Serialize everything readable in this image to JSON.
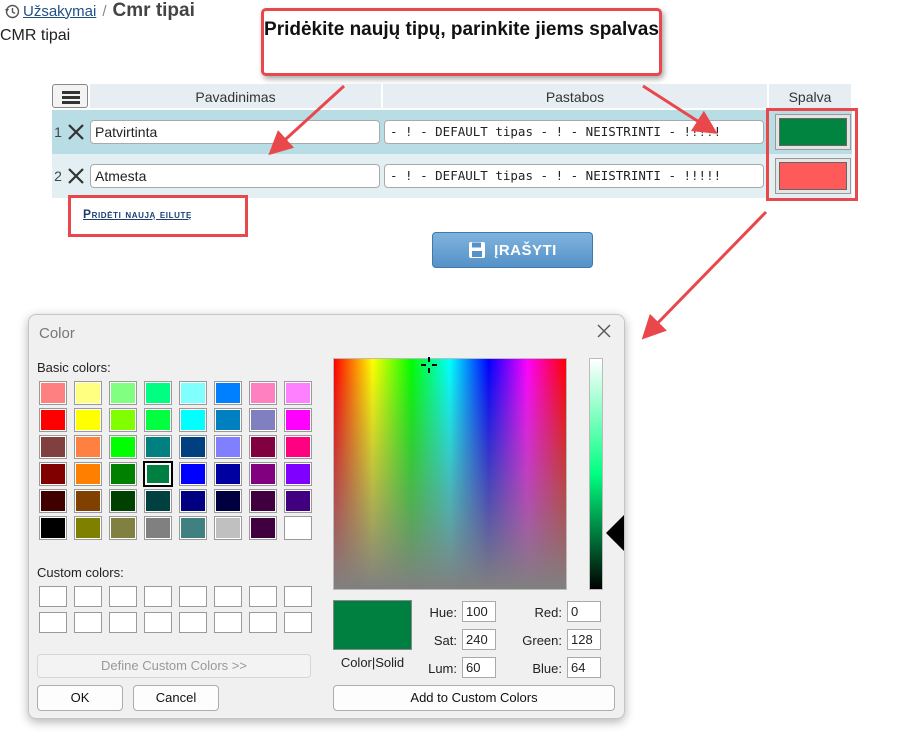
{
  "breadcrumb": {
    "parent": "Užsakymai",
    "separator": "/",
    "current": "Cmr tipai"
  },
  "subtitle": "CMR tipai",
  "callout": {
    "text": "Pridėkite naujų tipų, parinkite jiems spalvas"
  },
  "table": {
    "columns": {
      "name": "Pavadinimas",
      "notes": "Pastabos",
      "color": "Spalva"
    },
    "rows": [
      {
        "num": "1",
        "name": "Patvirtinta",
        "notes": "- ! - DEFAULT tipas - ! - NEISTRINTI - !!!!!",
        "color": "#00843f"
      },
      {
        "num": "2",
        "name": "Atmesta",
        "notes": "- ! - DEFAULT tipas - ! - NEISTRINTI - !!!!!",
        "color": "#ff5a5a"
      }
    ]
  },
  "add_row_label": "Pridėti naują eilutę",
  "save_label": "ĮRAŠYTI",
  "colors": {
    "accent_red": "#e8474b",
    "save_blue": "#6aa3d5"
  },
  "dialog": {
    "title": "Color",
    "basic_colors_label": "Basic colors:",
    "custom_colors_label": "Custom colors:",
    "define_custom_label": "Define Custom Colors >>",
    "ok_label": "OK",
    "cancel_label": "Cancel",
    "preview_label": "Color|Solid",
    "add_custom_label": "Add to Custom Colors",
    "fields": {
      "hue_label": "Hue:",
      "hue": "100",
      "sat_label": "Sat:",
      "sat": "240",
      "lum_label": "Lum:",
      "lum": "60",
      "red_label": "Red:",
      "red": "0",
      "green_label": "Green:",
      "green": "128",
      "blue_label": "Blue:",
      "blue": "64"
    },
    "basic_colors": [
      "#ff8080",
      "#ffff80",
      "#80ff80",
      "#00ff80",
      "#80ffff",
      "#0080ff",
      "#ff80c0",
      "#ff80ff",
      "#ff0000",
      "#ffff00",
      "#80ff00",
      "#00ff40",
      "#00ffff",
      "#0080c0",
      "#8080c0",
      "#ff00ff",
      "#804040",
      "#ff8040",
      "#00ff00",
      "#008080",
      "#004080",
      "#8080ff",
      "#800040",
      "#ff0080",
      "#800000",
      "#ff8000",
      "#008000",
      "#008040",
      "#0000ff",
      "#0000a0",
      "#800080",
      "#8000ff",
      "#400000",
      "#804000",
      "#004000",
      "#004040",
      "#000080",
      "#000040",
      "#400040",
      "#400080",
      "#000000",
      "#808000",
      "#808040",
      "#808080",
      "#408080",
      "#c0c0c0",
      "#400040",
      "#ffffff"
    ],
    "selected_color": "#008040"
  }
}
